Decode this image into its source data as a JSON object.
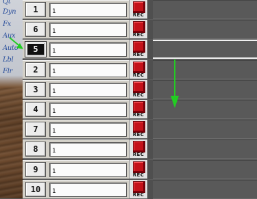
{
  "side_menu": {
    "items": [
      {
        "label": "Qt"
      },
      {
        "label": "Dyn"
      },
      {
        "label": "Fx"
      },
      {
        "label": "Aux"
      },
      {
        "label": "Auto"
      },
      {
        "label": "Lbl"
      },
      {
        "label": "Flr"
      }
    ]
  },
  "tracks": [
    {
      "number": "1",
      "name": "1",
      "rec_label": "REC"
    },
    {
      "number": "6",
      "name": "1",
      "rec_label": "REC"
    },
    {
      "number": "5",
      "name": "1",
      "rec_label": "REC",
      "selected": true
    },
    {
      "number": "2",
      "name": "1",
      "rec_label": "REC"
    },
    {
      "number": "3",
      "name": "1",
      "rec_label": "REC"
    },
    {
      "number": "4",
      "name": "1",
      "rec_label": "REC"
    },
    {
      "number": "7",
      "name": "1",
      "rec_label": "REC"
    },
    {
      "number": "8",
      "name": "1",
      "rec_label": "REC"
    },
    {
      "number": "9",
      "name": "1",
      "rec_label": "REC"
    },
    {
      "number": "10",
      "name": "1",
      "rec_label": "REC"
    }
  ],
  "colors": {
    "annotation_arrow": "#22cc22",
    "rec_led": "#c4121a",
    "lane_background": "#595959"
  },
  "annotations": [
    "green-drag-arrow-down",
    "green-pointer-arrow"
  ]
}
